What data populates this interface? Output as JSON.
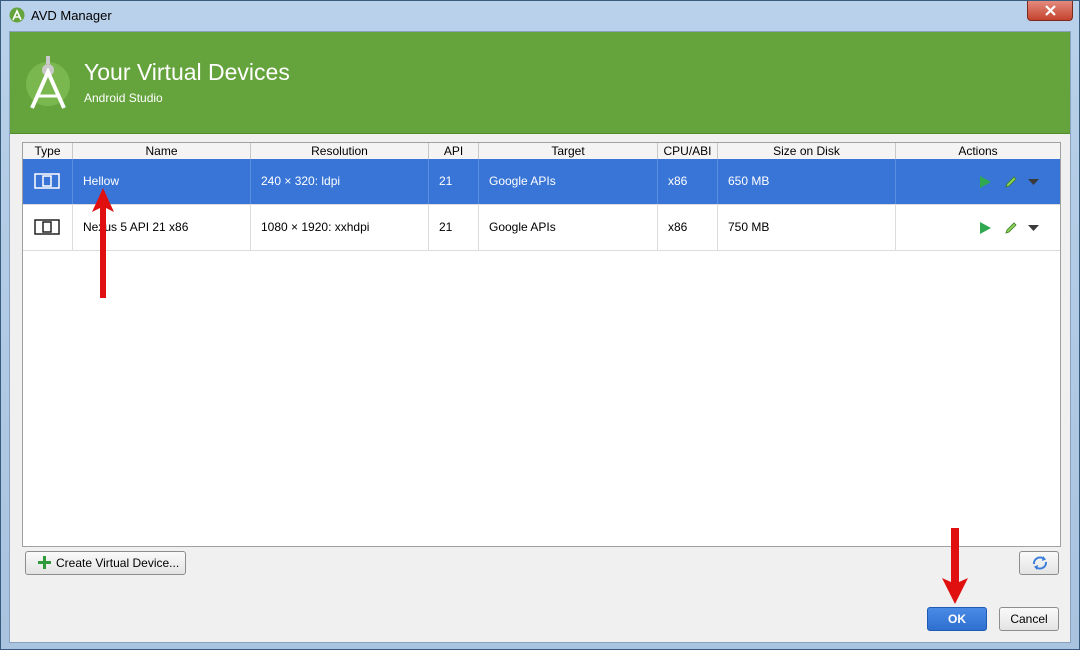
{
  "window": {
    "title": "AVD Manager"
  },
  "banner": {
    "heading": "Your Virtual Devices",
    "subheading": "Android Studio"
  },
  "table": {
    "columns": [
      "Type",
      "Name",
      "Resolution",
      "API",
      "Target",
      "CPU/ABI",
      "Size on Disk",
      "Actions"
    ],
    "rows": [
      {
        "name": "Hellow",
        "resolution": "240 × 320: ldpi",
        "api": "21",
        "target": "Google APIs",
        "cpu": "x86",
        "size": "650 MB",
        "selected": true
      },
      {
        "name": "Nexus 5 API 21 x86",
        "resolution": "1080 × 1920: xxhdpi",
        "api": "21",
        "target": "Google APIs",
        "cpu": "x86",
        "size": "750 MB",
        "selected": false
      }
    ]
  },
  "buttons": {
    "create": "Create Virtual Device...",
    "ok": "OK",
    "cancel": "Cancel"
  },
  "icons": {
    "app": "android-studio-icon",
    "close": "close-icon",
    "device": "phone-device-icon",
    "launch": "play-icon",
    "edit": "pencil-icon",
    "more": "chevron-down-icon",
    "add": "plus-icon",
    "refresh": "refresh-icon"
  },
  "colors": {
    "banner": "#65a33c",
    "selection": "#3875d7",
    "play": "#2fa84f",
    "annotation": "#e01010"
  }
}
